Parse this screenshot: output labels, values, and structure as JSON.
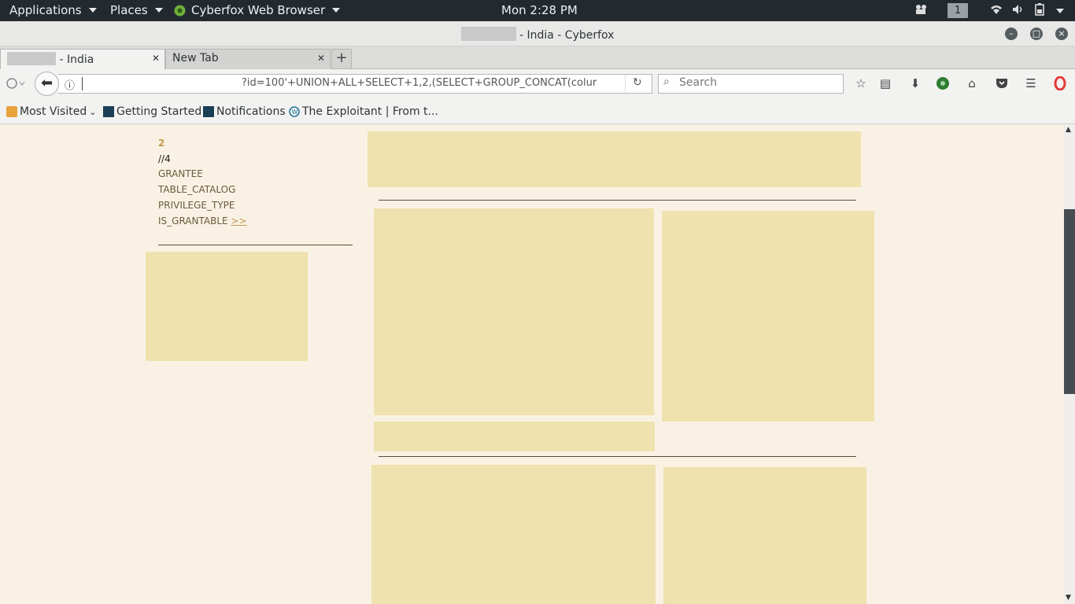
{
  "topbar": {
    "applications": "Applications",
    "places": "Places",
    "app_name": "Cyberfox Web Browser",
    "clock": "Mon  2:28 PM",
    "workspace": "1"
  },
  "window": {
    "title_suffix": "- India - Cyberfox"
  },
  "tabs": [
    {
      "label": "- India"
    },
    {
      "label": "New Tab"
    }
  ],
  "navbar": {
    "url_text": "?id=100'+UNION+ALL+SELECT+1,2,(SELECT+GROUP_CONCAT(colur",
    "search_placeholder": "Search"
  },
  "bookmarks": [
    {
      "label": "Most Visited"
    },
    {
      "label": "Getting Started"
    },
    {
      "label": "Notifications"
    },
    {
      "label": "The Exploitant | From t..."
    }
  ],
  "content": {
    "number": "2",
    "line2": "//4",
    "items": [
      "GRANTEE",
      "TABLE_CATALOG",
      "PRIVILEGE_TYPE",
      "IS_GRANTABLE"
    ],
    "more_link": ">>"
  },
  "colors": {
    "page_bg": "#f9f2e4",
    "placeholder_block": "#efe2ae",
    "text_brown": "#6b5a3c",
    "accent_gold": "#c29a4b"
  }
}
